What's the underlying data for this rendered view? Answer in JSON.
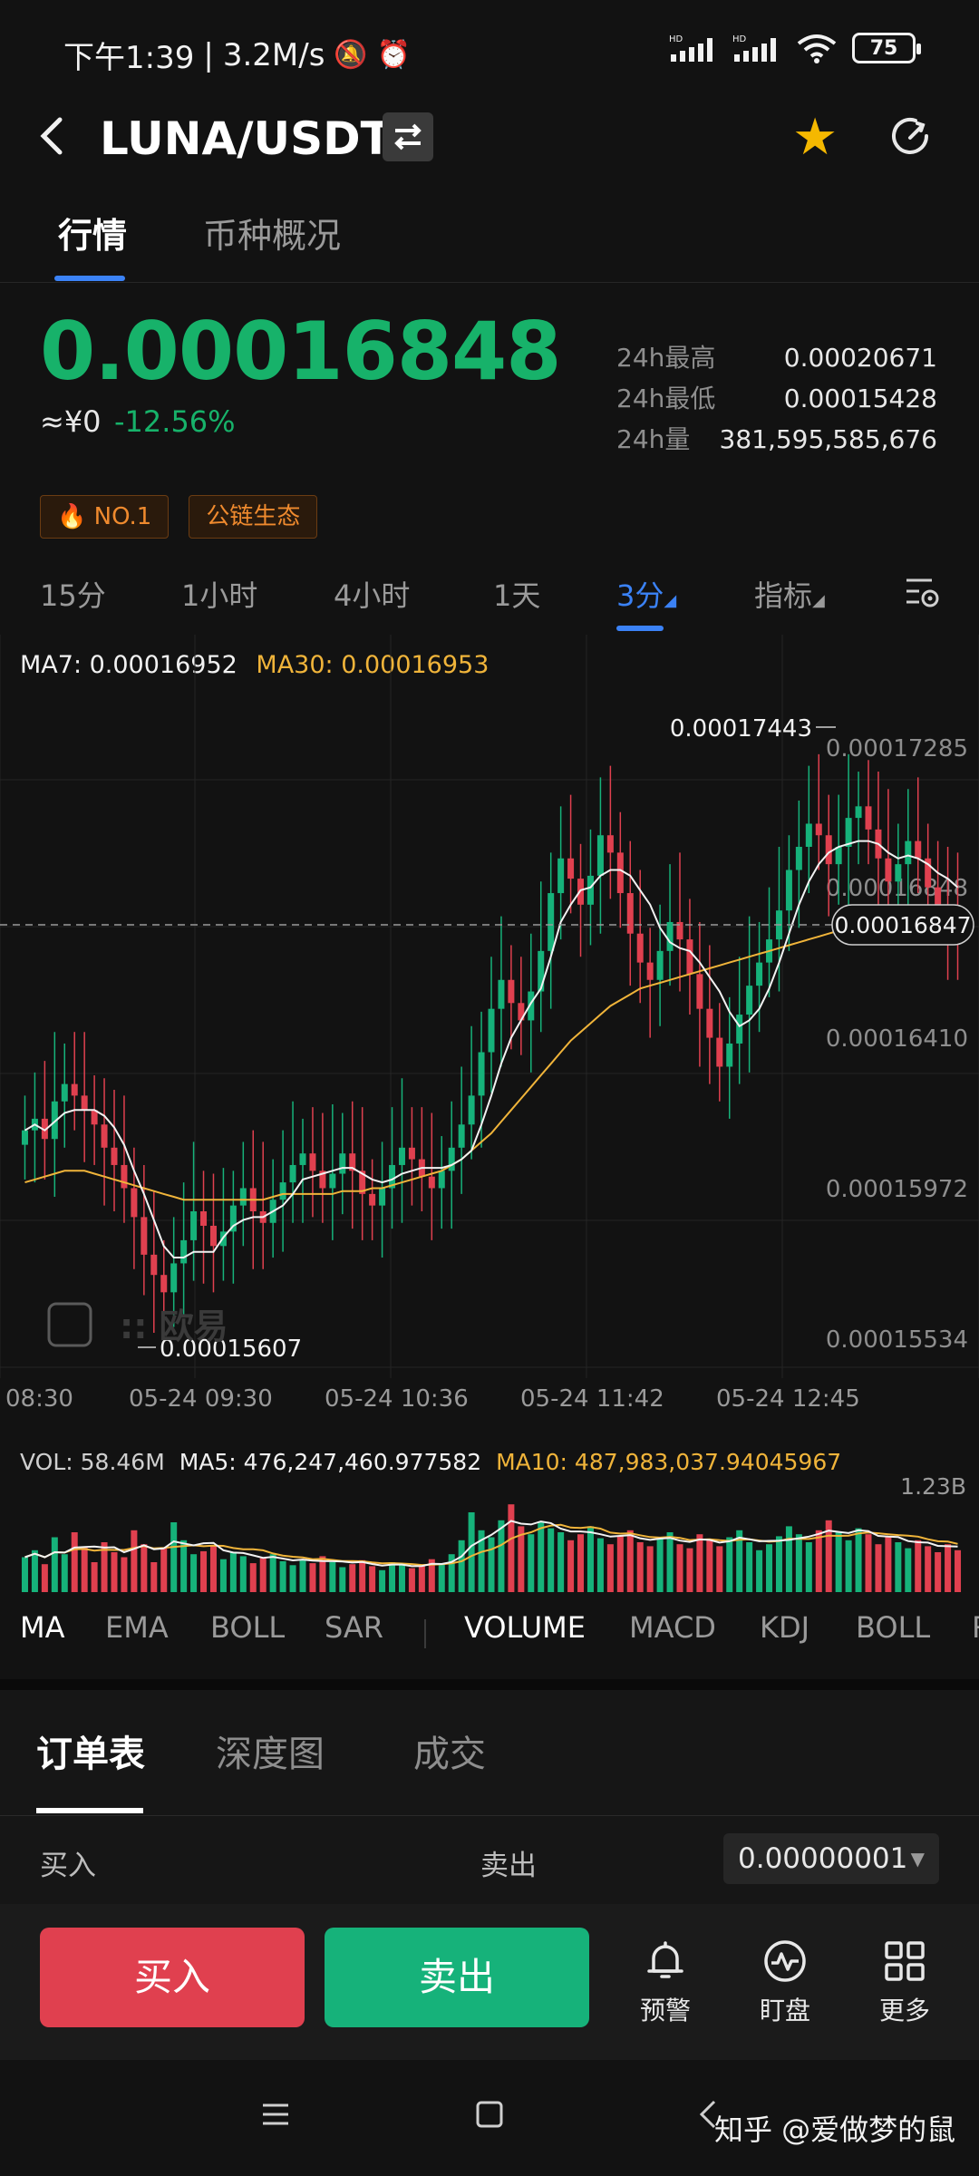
{
  "status_bar": {
    "time": "下午1:39",
    "speed": "3.2M/s",
    "battery": "75",
    "hd": "HD"
  },
  "header": {
    "pair": "LUNA/USDT"
  },
  "tabs": [
    "行情",
    "币种概况"
  ],
  "ticker": {
    "price": "0.00016848",
    "cny": "≈¥0",
    "change": "-12.56%",
    "stats": [
      {
        "label": "24h最高",
        "value": "0.00020671"
      },
      {
        "label": "24h最低",
        "value": "0.00015428"
      },
      {
        "label": "24h量",
        "value": "381,595,585,676"
      }
    ],
    "badges": [
      "NO.1",
      "公链生态"
    ]
  },
  "intervals": {
    "items": [
      "15分",
      "1小时",
      "4小时",
      "1天",
      "3分",
      "指标"
    ],
    "active": "3分"
  },
  "ma_legend": {
    "ma7": "MA7: 0.00016952",
    "ma30": "MA30: 0.00016953"
  },
  "chart_data": {
    "type": "candlestick",
    "y_ticks": [
      "0.00017285",
      "0.00016848",
      "0.00016410",
      "0.00015972",
      "0.00015534"
    ],
    "current_price_label": "0.00016847",
    "high_marker": "0.00017443",
    "low_marker": "0.00015607",
    "x_ticks": [
      "08:30",
      "05-24 09:30",
      "05-24 10:36",
      "05-24 11:42",
      "05-24 12:45"
    ],
    "logo_text": "欧易",
    "close": [
      0.0001618,
      0.0001622,
      0.0001615,
      0.0001628,
      0.0001634,
      0.000163,
      0.0001625,
      0.000162,
      0.0001612,
      0.0001606,
      0.0001598,
      0.0001588,
      0.0001575,
      0.0001568,
      0.0001562,
      0.0001572,
      0.000158,
      0.000159,
      0.0001585,
      0.0001578,
      0.0001583,
      0.0001592,
      0.0001598,
      0.000159,
      0.0001586,
      0.0001594,
      0.00016,
      0.0001606,
      0.000161,
      0.0001604,
      0.0001598,
      0.0001603,
      0.000161,
      0.0001604,
      0.0001596,
      0.0001592,
      0.0001598,
      0.0001606,
      0.0001612,
      0.0001608,
      0.0001602,
      0.0001598,
      0.0001604,
      0.0001612,
      0.000162,
      0.000163,
      0.0001645,
      0.000166,
      0.000167,
      0.0001662,
      0.0001656,
      0.0001666,
      0.000168,
      0.00017,
      0.0001712,
      0.0001705,
      0.0001696,
      0.0001706,
      0.000172,
      0.0001714,
      0.00017,
      0.0001686,
      0.0001676,
      0.000167,
      0.000168,
      0.000169,
      0.0001684,
      0.0001672,
      0.000166,
      0.000165,
      0.000164,
      0.0001648,
      0.0001658,
      0.0001668,
      0.0001676,
      0.0001684,
      0.0001694,
      0.0001708,
      0.0001716,
      0.0001724,
      0.000172,
      0.000171,
      0.0001716,
      0.0001726,
      0.000173,
      0.0001722,
      0.0001712,
      0.0001704,
      0.000171,
      0.0001718,
      0.0001712,
      0.0001702,
      0.0001696,
      0.000169,
      0.0001686
    ],
    "ma7": [
      0.0001618,
      0.000162,
      0.0001618,
      0.0001621,
      0.0001624,
      0.0001625,
      0.0001625,
      0.0001625,
      0.0001623,
      0.0001619,
      0.0001613,
      0.0001604,
      0.0001596,
      0.0001587,
      0.0001578,
      0.0001574,
      0.0001574,
      0.0001576,
      0.0001576,
      0.0001576,
      0.0001581,
      0.0001585,
      0.0001587,
      0.0001588,
      0.0001588,
      0.000159,
      0.0001592,
      0.0001596,
      0.0001601,
      0.0001602,
      0.0001603,
      0.0001604,
      0.0001605,
      0.0001605,
      0.0001603,
      0.0001601,
      0.00016,
      0.0001601,
      0.0001603,
      0.0001604,
      0.0001605,
      0.0001605,
      0.0001605,
      0.0001606,
      0.0001608,
      0.0001611,
      0.000162,
      0.000163,
      0.0001641,
      0.000165,
      0.0001656,
      0.0001662,
      0.0001667,
      0.0001678,
      0.000169,
      0.0001696,
      0.0001701,
      0.0001702,
      0.0001706,
      0.0001708,
      0.0001708,
      0.0001706,
      0.0001701,
      0.0001696,
      0.0001688,
      0.0001683,
      0.0001681,
      0.000168,
      0.0001676,
      0.0001671,
      0.0001666,
      0.0001659,
      0.0001654,
      0.0001656,
      0.000166,
      0.0001667,
      0.0001676,
      0.0001686,
      0.0001696,
      0.0001704,
      0.000171,
      0.0001714,
      0.0001716,
      0.0001717,
      0.0001718,
      0.0001718,
      0.0001717,
      0.0001714,
      0.0001712,
      0.0001713,
      0.0001712,
      0.000171,
      0.0001707,
      0.0001705,
      0.0001702
    ],
    "ma30": [
      0.00016,
      0.0001601,
      0.0001602,
      0.0001603,
      0.0001604,
      0.0001604,
      0.0001604,
      0.0001603,
      0.0001602,
      0.0001601,
      0.00016,
      0.0001599,
      0.0001598,
      0.0001597,
      0.0001596,
      0.0001595,
      0.0001594,
      0.0001594,
      0.0001594,
      0.0001594,
      0.0001594,
      0.0001594,
      0.0001594,
      0.0001594,
      0.0001594,
      0.0001595,
      0.0001596,
      0.0001596,
      0.0001596,
      0.0001596,
      0.0001596,
      0.0001596,
      0.0001597,
      0.0001597,
      0.0001597,
      0.0001598,
      0.0001598,
      0.0001599,
      0.00016,
      0.0001601,
      0.0001602,
      0.0001603,
      0.0001604,
      0.0001606,
      0.0001608,
      0.0001611,
      0.0001614,
      0.0001617,
      0.0001621,
      0.0001625,
      0.0001629,
      0.0001633,
      0.0001637,
      0.0001641,
      0.0001645,
      0.0001649,
      0.0001652,
      0.0001655,
      0.0001658,
      0.0001661,
      0.0001663,
      0.0001665,
      0.0001667,
      0.0001668,
      0.0001669,
      0.000167,
      0.0001671,
      0.0001672,
      0.0001673,
      0.0001674,
      0.0001675,
      0.0001676,
      0.0001677,
      0.0001678,
      0.0001679,
      0.000168,
      0.0001681,
      0.0001682,
      0.0001683,
      0.0001684,
      0.0001685,
      0.0001686,
      0.0001687,
      0.0001688,
      0.0001689,
      0.000169,
      0.0001691,
      0.0001692,
      0.0001692,
      0.0001693,
      0.0001694,
      0.0001694,
      0.0001695,
      0.0001695,
      0.0001695
    ],
    "volume_max_label": "1.23B",
    "volume": [
      0.35,
      0.42,
      0.28,
      0.55,
      0.38,
      0.6,
      0.45,
      0.3,
      0.5,
      0.4,
      0.35,
      0.62,
      0.48,
      0.3,
      0.44,
      0.7,
      0.52,
      0.38,
      0.41,
      0.46,
      0.33,
      0.4,
      0.36,
      0.29,
      0.34,
      0.38,
      0.31,
      0.27,
      0.33,
      0.29,
      0.36,
      0.3,
      0.25,
      0.28,
      0.32,
      0.26,
      0.22,
      0.3,
      0.28,
      0.24,
      0.27,
      0.33,
      0.29,
      0.38,
      0.52,
      0.8,
      0.62,
      0.55,
      0.72,
      0.88,
      0.66,
      0.58,
      0.7,
      0.64,
      0.6,
      0.52,
      0.58,
      0.66,
      0.54,
      0.48,
      0.56,
      0.62,
      0.5,
      0.46,
      0.54,
      0.6,
      0.48,
      0.44,
      0.58,
      0.52,
      0.46,
      0.55,
      0.62,
      0.5,
      0.42,
      0.48,
      0.56,
      0.66,
      0.58,
      0.5,
      0.62,
      0.72,
      0.6,
      0.52,
      0.64,
      0.58,
      0.48,
      0.56,
      0.5,
      0.44,
      0.52,
      0.46,
      0.4,
      0.48,
      0.42
    ]
  },
  "vol_legend": {
    "vol": "VOL: 58.46M",
    "ma5": "MA5: 476,247,460.977582",
    "ma10": "MA10: 487,983,037.94045967"
  },
  "indicators": [
    "MA",
    "EMA",
    "BOLL",
    "SAR",
    "VOLUME",
    "MACD",
    "KDJ",
    "BOLL",
    "R"
  ],
  "panel": {
    "tabs": [
      "订单表",
      "深度图",
      "成交"
    ],
    "buy_label": "买入",
    "sell_label": "卖出",
    "precision": "0.00000001"
  },
  "actions": {
    "buy": "买入",
    "sell": "卖出",
    "items": [
      "预警",
      "盯盘",
      "更多"
    ]
  },
  "watermark": "知乎 @爱做梦的鼠",
  "colors": {
    "up": "#16b27a",
    "down": "#e0404f",
    "accent": "#3b82f6",
    "ma30": "#f0b43a"
  }
}
